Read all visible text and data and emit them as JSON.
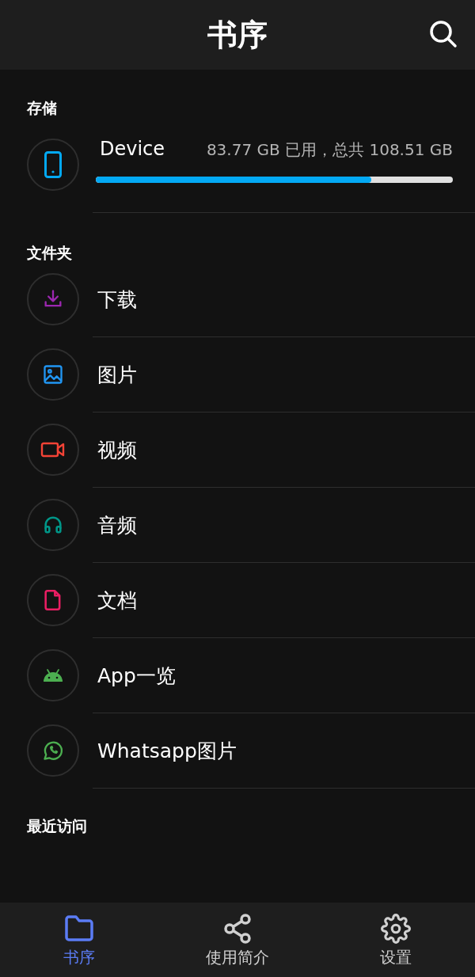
{
  "header": {
    "title": "书序"
  },
  "storage": {
    "label": "存储",
    "device": {
      "name": "Device",
      "usage": "83.77 GB 已用，总共 108.51 GB",
      "level": 0.772
    }
  },
  "folders": {
    "label": "文件夹",
    "items": [
      {
        "label": "下载",
        "kind": "download",
        "color": "#9c27b0"
      },
      {
        "label": "图片",
        "kind": "image",
        "color": "#2196f3"
      },
      {
        "label": "视频",
        "kind": "video",
        "color": "#f44336"
      },
      {
        "label": "音频",
        "kind": "audio",
        "color": "#009688"
      },
      {
        "label": "文档",
        "kind": "document",
        "color": "#e91e63"
      },
      {
        "label": "App一览",
        "kind": "android",
        "color": "#4caf50"
      },
      {
        "label": "Whatsapp图片",
        "kind": "whatsapp",
        "color": "#4caf50"
      }
    ]
  },
  "recent": {
    "label": "最近访问"
  },
  "bottom_nav": [
    {
      "label": "书序",
      "kind": "folder",
      "selected": true
    },
    {
      "label": "使用简介",
      "kind": "share",
      "selected": false
    },
    {
      "label": "设置",
      "kind": "settings",
      "selected": false
    }
  ]
}
